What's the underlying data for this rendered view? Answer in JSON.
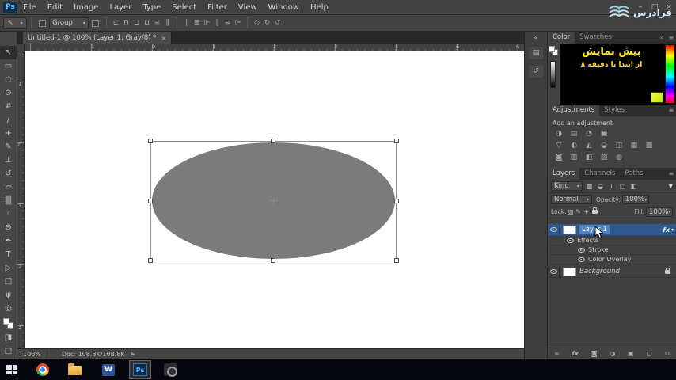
{
  "menu_bar": {
    "app_badge": "Ps",
    "items": [
      "File",
      "Edit",
      "Image",
      "Layer",
      "Type",
      "Select",
      "Filter",
      "View",
      "Window",
      "Help"
    ]
  },
  "window": {
    "controls": {
      "minimize": "–",
      "maximize": "□",
      "close": "×"
    }
  },
  "watermark": {
    "brand": "فرادرس"
  },
  "options_bar": {
    "auto_select_value": "Group"
  },
  "document_tab": {
    "title": "Untitled-1 @ 100% (Layer 1, Gray/8) *",
    "close": "×"
  },
  "rulers": {
    "horizontal": [
      "1",
      "0",
      "1",
      "2",
      "3",
      "4",
      "5",
      "6"
    ],
    "vertical": [
      "1",
      "0",
      "1",
      "2",
      "3"
    ]
  },
  "status_bar": {
    "zoom": "100%",
    "doc_size": "Doc: 108.8K/108.8K"
  },
  "preview_overlay": {
    "line1": "پیش نمایش",
    "line2": "از ابتدا تا دقیقه ۸"
  },
  "panels": {
    "color": {
      "tabs": [
        "Color",
        "Swatches"
      ]
    },
    "adjustments": {
      "tabs": [
        "Adjustments",
        "Styles"
      ],
      "heading": "Add an adjustment"
    },
    "layers": {
      "tabs": [
        "Layers",
        "Channels",
        "Paths"
      ],
      "filter_kind": "Kind",
      "blend_mode": "Normal",
      "opacity_label": "Opacity:",
      "opacity_value": "100%",
      "lock_label": "Lock:",
      "fill_label": "Fill:",
      "fill_value": "100%",
      "rows": {
        "layer1": {
          "name": "Layer 1",
          "fx": "fx"
        },
        "effects": {
          "name": "Effects"
        },
        "stroke": {
          "name": "Stroke"
        },
        "color_overlay": {
          "name": "Color Overlay"
        },
        "background": {
          "name": "Background"
        }
      }
    }
  },
  "taskbar": {
    "word_label": "W",
    "ps_label": "Ps"
  },
  "colors": {
    "selected_layer_blue": "#30588a",
    "layer_name_highlight": "#4f82c2",
    "panel_background": "#424242",
    "canvas_white": "#ffffff",
    "ellipse_gray": "#7b7b7b",
    "overlay_yellow": "#ffe81a",
    "faradars_blue": "#a8dcf2",
    "photoshop_icon_blue": "#4db3ff"
  },
  "icons": {
    "chevron": "▾",
    "collapse": "«",
    "collapse_right": "»",
    "menu": "≡",
    "funnel": "▼",
    "play": "▶",
    "align": [
      "⊏",
      "⊓",
      "⊐",
      "⊔",
      "≡",
      "∥"
    ],
    "distribute": [
      "∣",
      "≣",
      "⊪",
      "∥",
      "≡",
      "⊫"
    ],
    "three_d": [
      "◇",
      "↻",
      "↺"
    ],
    "tools": {
      "move": "↖",
      "marquee": "▭",
      "lasso": "◌",
      "quick_select": "⊙",
      "crop": "#",
      "eyedropper": "∕",
      "healing": "+",
      "brush": "✎",
      "clone_stamp": "⊥",
      "history_brush": "↺",
      "eraser": "▱",
      "gradient": "▒",
      "blur": "◦",
      "dodge": "⊖",
      "pen": "✒",
      "type": "T",
      "path_select": "▷",
      "shape": "□",
      "hand": "ψ",
      "zoom": "◎",
      "quick_mask": "◨",
      "screen_mode": "▢"
    },
    "adjustments": [
      "◑",
      "▤",
      "◔",
      "▣",
      "▽",
      "◐",
      "◭",
      "◒",
      "◫",
      "▦",
      "▩",
      "◙",
      "▥",
      "◧",
      "▨",
      "◍"
    ],
    "filter": [
      "▩",
      "◒",
      "T",
      "□",
      "◧"
    ],
    "lock": [
      "▨",
      "✎",
      "+"
    ],
    "dock": [
      "▤",
      "↺"
    ],
    "layers_bottom": [
      "∞",
      "fx",
      "◙",
      "◑",
      "▣",
      "▢",
      "⊔"
    ]
  }
}
